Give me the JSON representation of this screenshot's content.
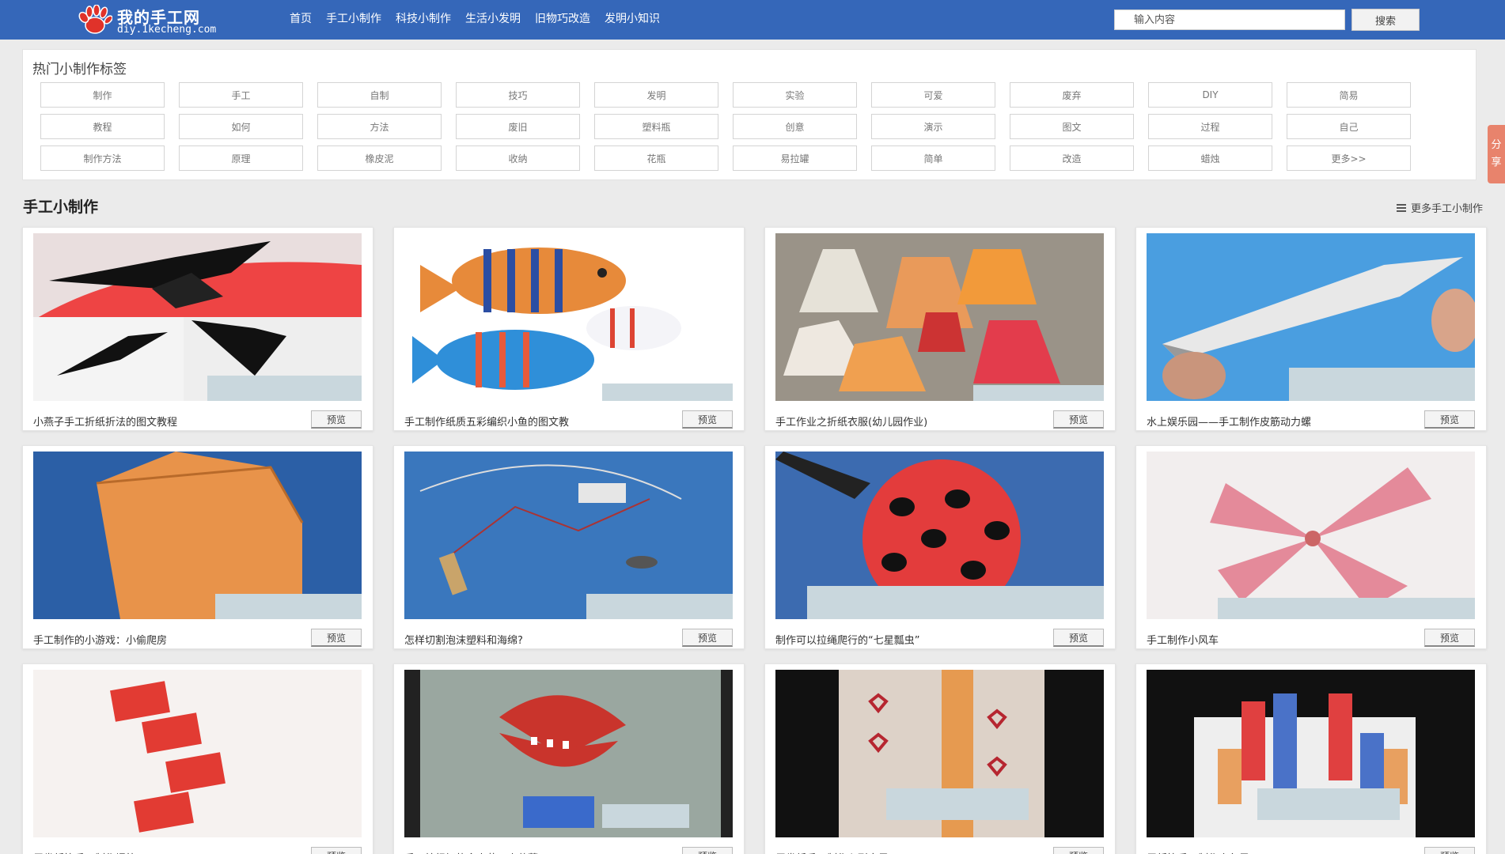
{
  "header": {
    "logo_title": "我的手工网",
    "logo_sub": "diy.1kecheng.com",
    "nav": [
      "首页",
      "手工小制作",
      "科技小制作",
      "生活小发明",
      "旧物巧改造",
      "发明小知识"
    ],
    "search_placeholder": "输入内容",
    "search_button": "搜索",
    "bg_color": "#3567b9"
  },
  "tags": {
    "title": "热门小制作标签",
    "items": [
      "制作",
      "手工",
      "自制",
      "技巧",
      "发明",
      "实验",
      "可爱",
      "废弃",
      "DIY",
      "简易",
      "教程",
      "如何",
      "方法",
      "废旧",
      "塑料瓶",
      "创意",
      "演示",
      "图文",
      "过程",
      "自己",
      "制作方法",
      "原理",
      "橡皮泥",
      "收纳",
      "花瓶",
      "易拉罐",
      "简单",
      "改造",
      "蜡烛",
      "更多>>"
    ]
  },
  "section": {
    "title": "手工小制作",
    "more": "更多手工小制作"
  },
  "preview_label": "预览",
  "cards": [
    {
      "title": "小燕子手工折纸折法的图文教程"
    },
    {
      "title": "手工制作纸质五彩编织小鱼的图文教"
    },
    {
      "title": "手工作业之折纸衣服(幼儿园作业)"
    },
    {
      "title": "水上娱乐园——手工制作皮筋动力螺"
    },
    {
      "title": "手工制作的小游戏：小偷爬房"
    },
    {
      "title": "怎样切割泡沫塑料和海绵?"
    },
    {
      "title": "制作可以拉绳爬行的“七星瓢虫”"
    },
    {
      "title": "手工制作小风车"
    },
    {
      "title": "用卷纸筒手工制作爆竹"
    },
    {
      "title": "手工编织好的食人花，小草莓"
    },
    {
      "title": "用卷纸手工制作心形窗子"
    },
    {
      "title": "用纸筒手工制作小兔子"
    }
  ],
  "share": [
    "分",
    "享"
  ]
}
